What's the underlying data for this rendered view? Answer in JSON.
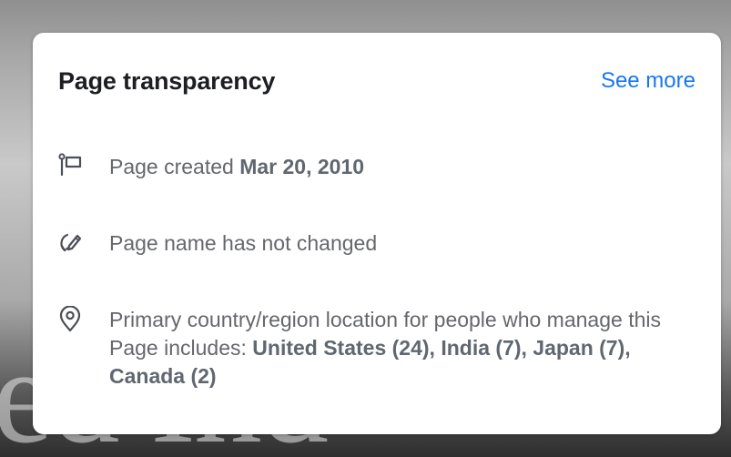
{
  "background": {
    "watermark_text": "ed Ind"
  },
  "card": {
    "title": "Page transparency",
    "see_more_label": "See more",
    "accent_color": "#1877f2",
    "items": [
      {
        "icon": "flag-icon",
        "text": "Page created ",
        "bold": "Mar 20, 2010"
      },
      {
        "icon": "edit-circle-icon",
        "text": "Page name has not changed"
      },
      {
        "icon": "location-pin-icon",
        "text": "Primary country/region location for people who manage this Page includes: ",
        "bold": "United States (24), India (7), Japan (7), Canada (2)"
      }
    ]
  }
}
